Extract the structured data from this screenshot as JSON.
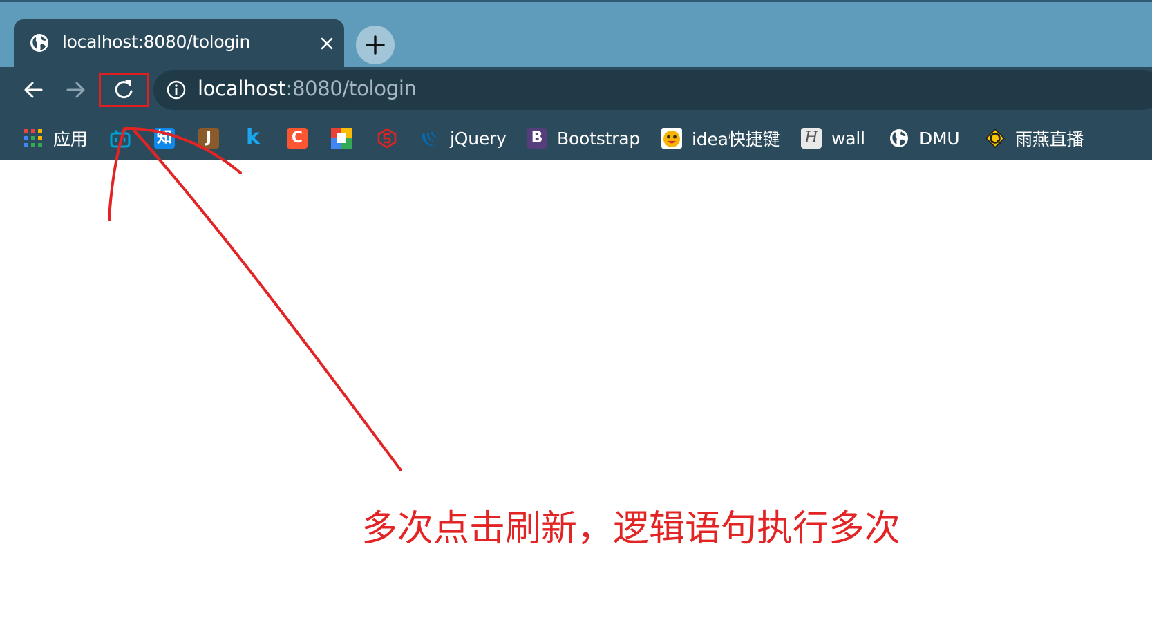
{
  "tab": {
    "title": "localhost:8080/tologin",
    "favicon": "globe-icon"
  },
  "newtab": {
    "icon": "plus-icon"
  },
  "omnibox": {
    "host": "localhost",
    "path": ":8080/tologin",
    "icon": "info-icon"
  },
  "bookmarks": [
    {
      "label": "应用",
      "icon": "apps-grid-icon"
    },
    {
      "label": "",
      "icon": "bilibili-icon"
    },
    {
      "label": "",
      "icon": "zhihu-icon",
      "glyph": "知"
    },
    {
      "label": "",
      "icon": "j-letter-icon",
      "glyph": "J"
    },
    {
      "label": "",
      "icon": "k-letter-icon",
      "glyph": "k"
    },
    {
      "label": "",
      "icon": "c-letter-icon",
      "glyph": "C"
    },
    {
      "label": "",
      "icon": "colored-squares-icon"
    },
    {
      "label": "",
      "icon": "red-shield-icon"
    },
    {
      "label": "jQuery",
      "icon": "jquery-icon"
    },
    {
      "label": "Bootstrap",
      "icon": "bootstrap-icon",
      "glyph": "B"
    },
    {
      "label": "idea快捷键",
      "icon": "smiley-face-icon"
    },
    {
      "label": "wall",
      "icon": "h-script-icon",
      "glyph": "H"
    },
    {
      "label": "DMU",
      "icon": "globe-icon"
    },
    {
      "label": "雨燕直播",
      "icon": "swift-live-icon"
    }
  ],
  "annotation": {
    "text": "多次点击刷新，逻辑语句执行多次"
  },
  "colors": {
    "tabstrip": "#5f9cbb",
    "toolbar": "#2b4a5c",
    "annotation": "#e32424"
  }
}
